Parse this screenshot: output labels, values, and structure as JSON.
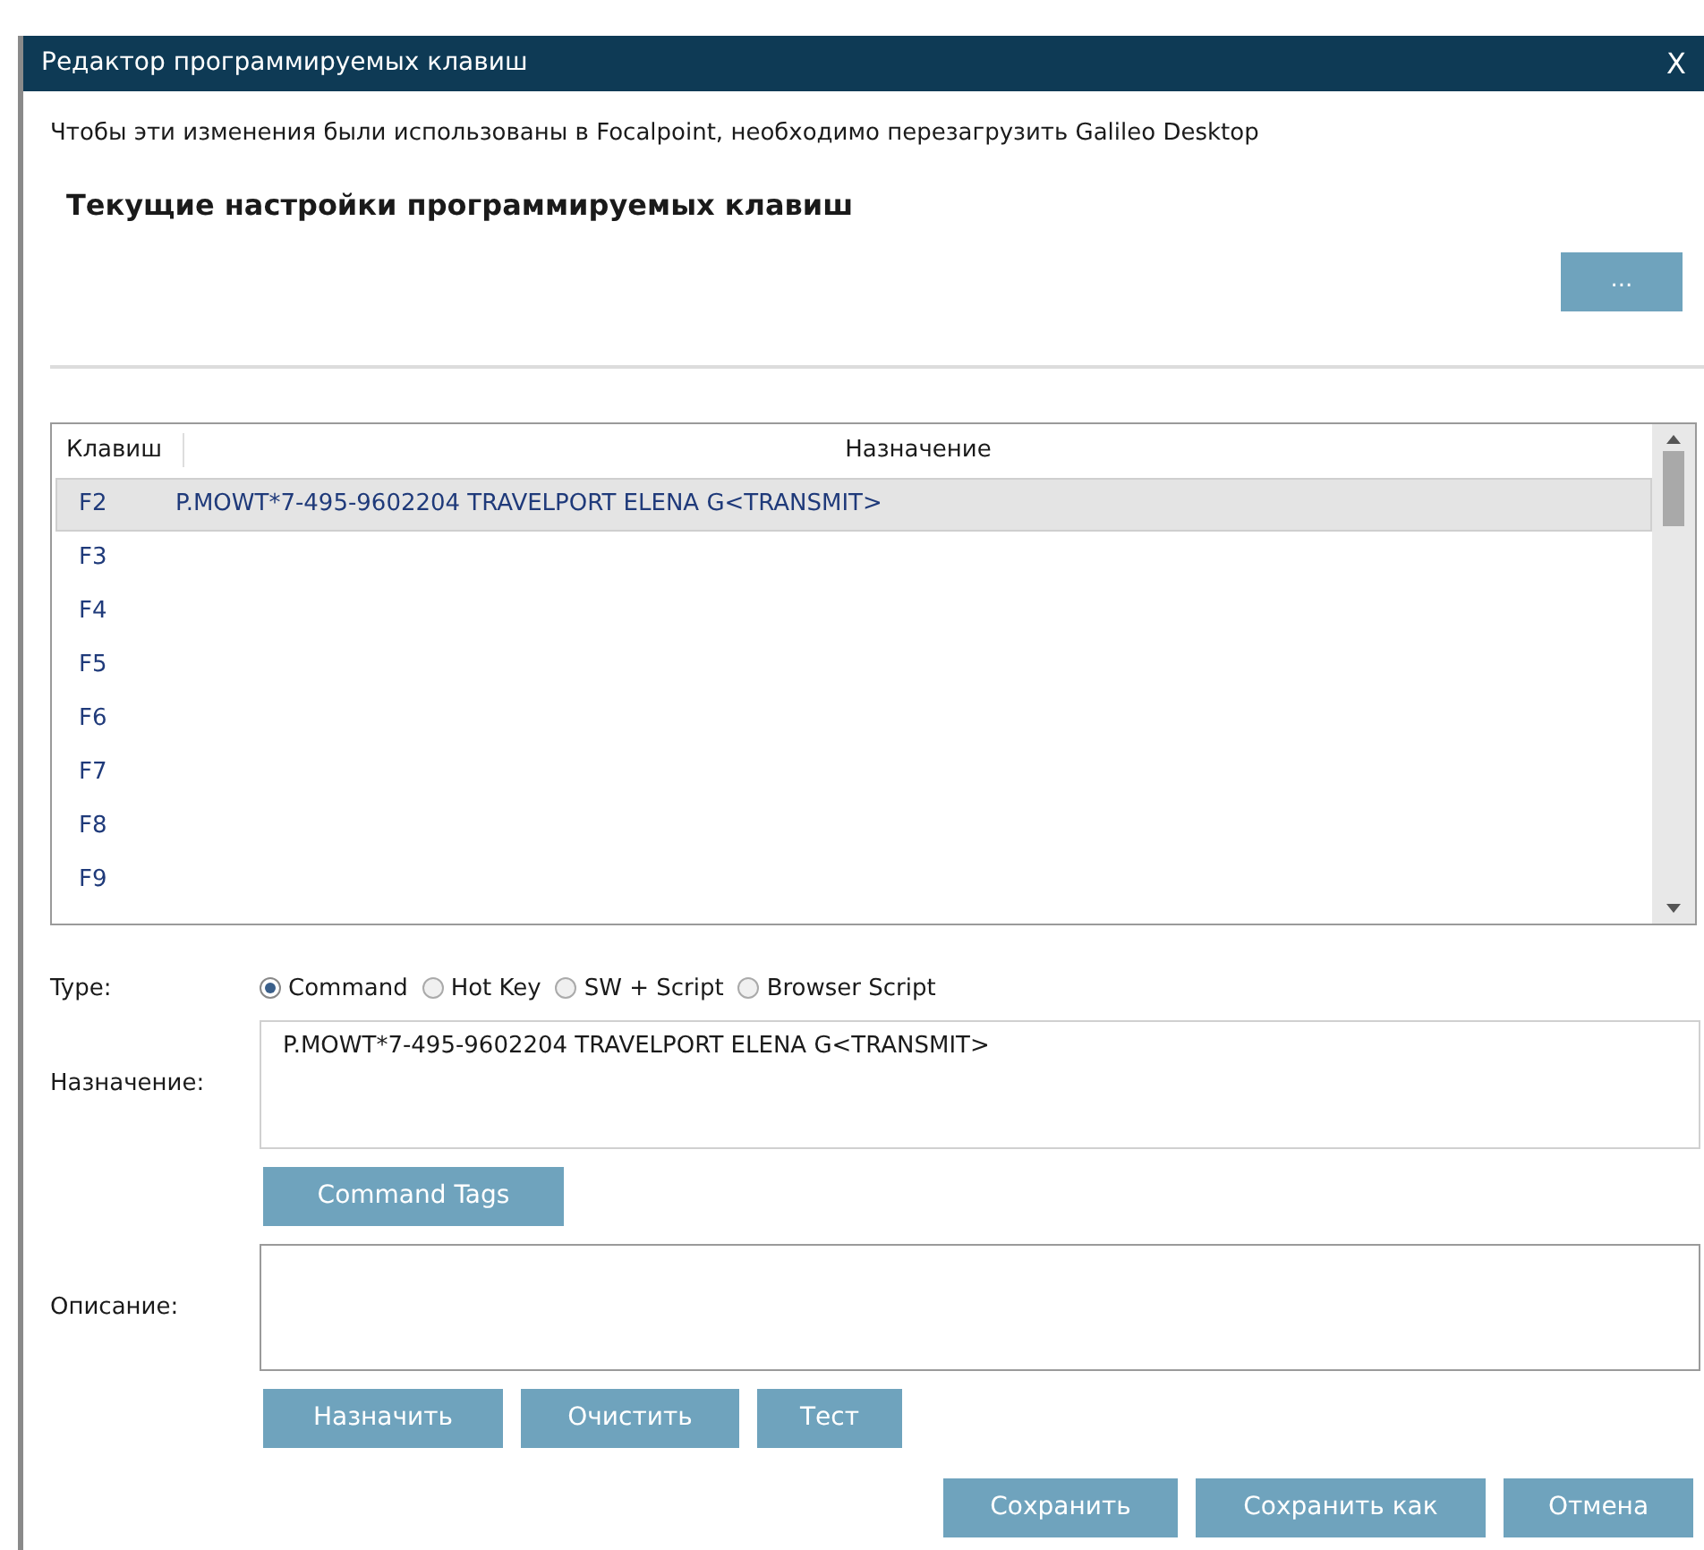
{
  "window": {
    "title": "Редактор программируемых клавиш",
    "close": "X"
  },
  "notice": "Чтобы эти изменения были использованы в Focalpoint, необходимо перезагрузить Galileo Desktop",
  "heading": "Текущие настройки программируемых клавиш",
  "more_button": "...",
  "table": {
    "columns": [
      "Клавиш",
      "Назначение"
    ],
    "rows": [
      {
        "key": "F2",
        "assignment": "P.MOWT*7-495-9602204 TRAVELPORT ELENA G<TRANSMIT>",
        "selected": true
      },
      {
        "key": "F3",
        "selected": false
      },
      {
        "key": "F4",
        "selected": false
      },
      {
        "key": "F5",
        "selected": false
      },
      {
        "key": "F6",
        "selected": false
      },
      {
        "key": "F7",
        "selected": false
      },
      {
        "key": "F8",
        "selected": false
      },
      {
        "key": "F9",
        "selected": false
      }
    ]
  },
  "type": {
    "label": "Type:",
    "options": [
      {
        "label": "Command",
        "selected": true
      },
      {
        "label": "Hot Key",
        "selected": false
      },
      {
        "label": "SW + Script",
        "selected": false
      },
      {
        "label": "Browser Script",
        "selected": false
      }
    ]
  },
  "assignment": {
    "label": "Назначение:",
    "value": "P.MOWT*7-495-9602204 TRAVELPORT ELENA G<TRANSMIT>"
  },
  "command_tags_button": "Command Tags",
  "description": {
    "label": "Описание:"
  },
  "action_buttons": [
    "Назначить",
    "Очистить",
    "Тест"
  ],
  "footer_buttons": [
    "Сохранить",
    "Сохранить как",
    "Отмена"
  ]
}
